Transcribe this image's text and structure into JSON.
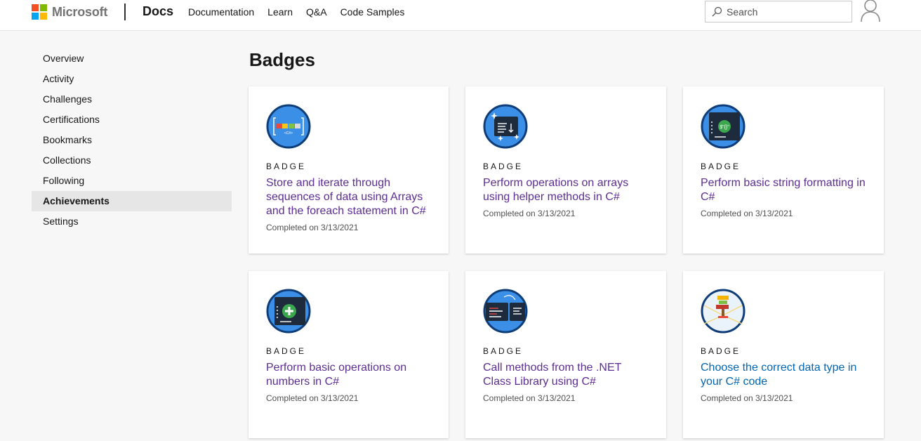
{
  "header": {
    "brand": "Microsoft",
    "docs": "Docs",
    "nav": [
      "Documentation",
      "Learn",
      "Q&A",
      "Code Samples"
    ],
    "search_placeholder": "Search"
  },
  "sidebar": {
    "items": [
      {
        "label": "Overview"
      },
      {
        "label": "Activity"
      },
      {
        "label": "Challenges"
      },
      {
        "label": "Certifications"
      },
      {
        "label": "Bookmarks"
      },
      {
        "label": "Collections"
      },
      {
        "label": "Following"
      },
      {
        "label": "Achievements",
        "active": true
      },
      {
        "label": "Settings"
      }
    ]
  },
  "main": {
    "title": "Badges",
    "cards": [
      {
        "label": "BADGE",
        "title": "Store and iterate through sequences of data using Arrays and the foreach statement in C#",
        "date": "Completed on 3/13/2021",
        "icon": "arrays-badge-icon"
      },
      {
        "label": "BADGE",
        "title": "Perform operations on arrays using helper methods in C#",
        "date": "Completed on 3/13/2021",
        "icon": "array-helper-badge-icon"
      },
      {
        "label": "BADGE",
        "title": "Perform basic string formatting in C#",
        "date": "Completed on 3/13/2021",
        "icon": "string-format-badge-icon"
      },
      {
        "label": "BADGE",
        "title": "Perform basic operations on numbers in C#",
        "date": "Completed on 3/13/2021",
        "icon": "number-ops-badge-icon"
      },
      {
        "label": "BADGE",
        "title": "Call methods from the .NET Class Library using C#",
        "date": "Completed on 3/13/2021",
        "icon": "class-library-badge-icon"
      },
      {
        "label": "BADGE",
        "title": "Choose the correct data type in your C# code",
        "date": "Completed on 3/13/2021",
        "icon": "data-type-badge-icon"
      }
    ]
  },
  "colors": {
    "link_visited": "#5c2d91",
    "link": "#0065b3",
    "badge_blue": "#3b8fe6"
  }
}
